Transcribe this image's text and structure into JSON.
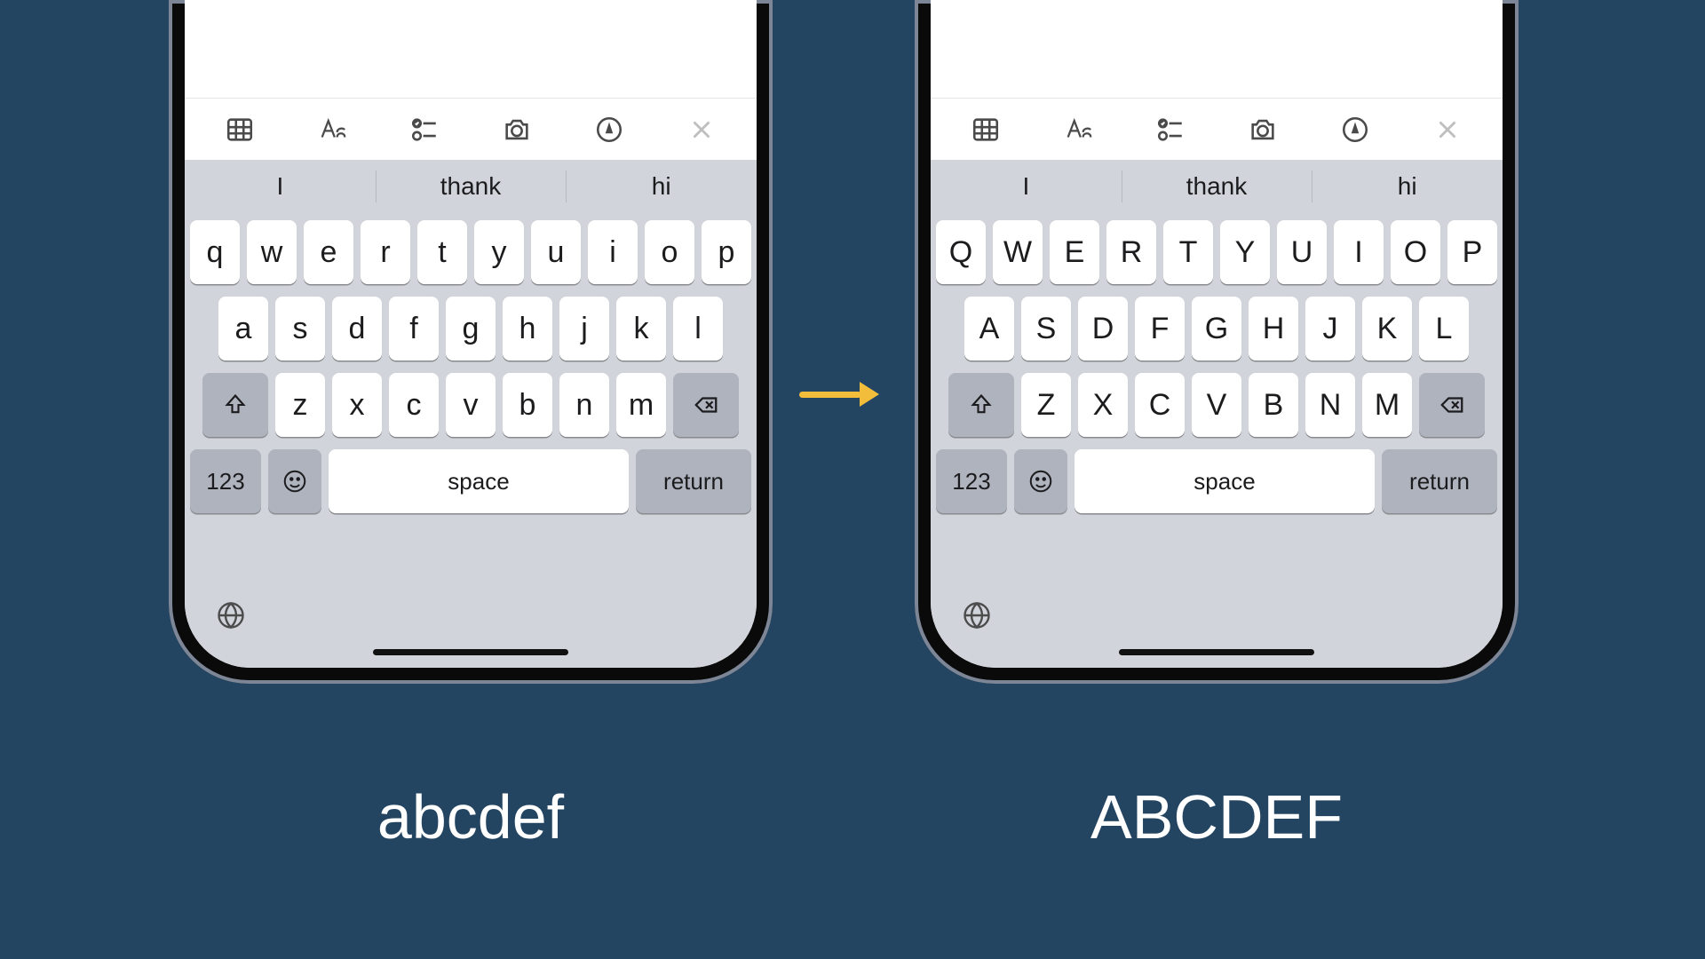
{
  "toolbar_icons": [
    "table",
    "text-format",
    "checklist",
    "camera",
    "markup",
    "close"
  ],
  "suggestions": [
    "I",
    "thank",
    "hi"
  ],
  "keyboard_lower": {
    "row1": [
      "q",
      "w",
      "e",
      "r",
      "t",
      "y",
      "u",
      "i",
      "o",
      "p"
    ],
    "row2": [
      "a",
      "s",
      "d",
      "f",
      "g",
      "h",
      "j",
      "k",
      "l"
    ],
    "row3": [
      "z",
      "x",
      "c",
      "v",
      "b",
      "n",
      "m"
    ],
    "num_key": "123",
    "space_label": "space",
    "return_label": "return"
  },
  "keyboard_upper": {
    "row1": [
      "Q",
      "W",
      "E",
      "R",
      "T",
      "Y",
      "U",
      "I",
      "O",
      "P"
    ],
    "row2": [
      "A",
      "S",
      "D",
      "F",
      "G",
      "H",
      "J",
      "K",
      "L"
    ],
    "row3": [
      "Z",
      "X",
      "C",
      "V",
      "B",
      "N",
      "M"
    ],
    "num_key": "123",
    "space_label": "space",
    "return_label": "return"
  },
  "captions": {
    "left": "abcdef",
    "right": "ABCDEF"
  },
  "colors": {
    "bg": "#234562",
    "arrow": "#f2bd3a",
    "key_bg": "#ffffff",
    "func_key": "#aeb3bd",
    "kb_bg": "#d1d4da"
  }
}
